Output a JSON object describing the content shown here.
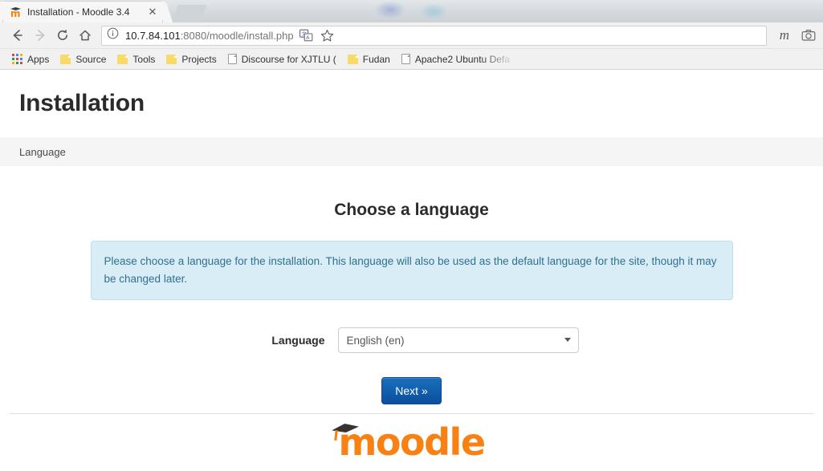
{
  "browser": {
    "tab": {
      "title": "Installation - Moodle 3.4",
      "favicon_name": "moodle-favicon",
      "close_label": "✕"
    },
    "nav": {
      "back_label": "Back",
      "forward_label": "Forward",
      "reload_label": "Reload",
      "home_label": "Home"
    },
    "omnibox": {
      "url_host": "10.7.84.101",
      "url_path": ":8080/moodle/install.php",
      "full_url": "10.7.84.101:8080/moodle/install.php",
      "info_icon": "page-info-icon",
      "translate_icon": "translate-icon",
      "bookmark_icon": "star-icon"
    },
    "extensions": [
      {
        "name": "m-extension",
        "label": "m"
      },
      {
        "name": "camera-extension",
        "label": "camera-icon"
      }
    ],
    "bookmarks": [
      {
        "label": "Apps",
        "icon": "apps-grid-icon"
      },
      {
        "label": "Source",
        "icon": "folder-icon"
      },
      {
        "label": "Tools",
        "icon": "folder-icon"
      },
      {
        "label": "Projects",
        "icon": "folder-icon"
      },
      {
        "label": "Discourse for XJTLU (",
        "icon": "document-icon"
      },
      {
        "label": "Fudan",
        "icon": "folder-icon"
      },
      {
        "label": "Apache2 Ubuntu Defa",
        "icon": "document-icon"
      }
    ]
  },
  "page": {
    "title": "Installation",
    "breadcrumb": "Language",
    "heading": "Choose a language",
    "alert_text": "Please choose a language for the installation. This language will also be used as the default language for the site, though it may be changed later.",
    "form": {
      "language_label": "Language",
      "language_value": "English (en)",
      "language_options": [
        "English (en)"
      ]
    },
    "next_button": "Next »",
    "footer_logo_text": "moodle"
  },
  "colors": {
    "accent_orange": "#f98012",
    "button_blue": "#0b4f9e",
    "alert_bg": "#d9edf7",
    "alert_border": "#bcdff1",
    "alert_text": "#31708f",
    "breadcrumb_bg": "#f5f5f5"
  }
}
